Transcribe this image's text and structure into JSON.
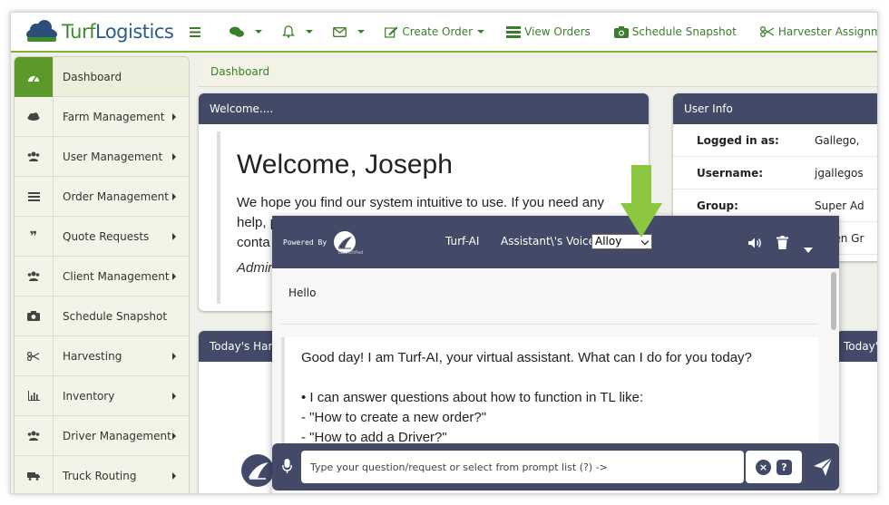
{
  "logo": {
    "part1": "Turf",
    "part2": "Logistics"
  },
  "nav": {
    "create_order": "Create Order",
    "view_orders": "View Orders",
    "schedule_snapshot": "Schedule Snapshot",
    "harvester_assignment": "Harvester Assignment"
  },
  "sidebar": {
    "items": [
      {
        "label": "Dashboard",
        "icon": "dashboard-icon"
      },
      {
        "label": "Farm Management",
        "icon": "cloud-icon"
      },
      {
        "label": "User Management",
        "icon": "users-icon"
      },
      {
        "label": "Order Management",
        "icon": "list-icon"
      },
      {
        "label": "Quote Requests",
        "icon": "quote-icon"
      },
      {
        "label": "Client Management",
        "icon": "users-icon"
      },
      {
        "label": "Schedule Snapshot",
        "icon": "camera-icon"
      },
      {
        "label": "Harvesting",
        "icon": "scissors-icon"
      },
      {
        "label": "Inventory",
        "icon": "bar-chart-icon"
      },
      {
        "label": "Driver Management",
        "icon": "users-icon"
      },
      {
        "label": "Truck Routing",
        "icon": "truck-icon"
      }
    ]
  },
  "breadcrumb": "Dashboard",
  "welcome": {
    "header": "Welcome....",
    "title": "Welcome, Joseph",
    "text_1": "We hope you find our system intuitive to use. If you need any",
    "text_2": "help, p",
    "text_3": "conta",
    "sign": "Admir"
  },
  "user_info": {
    "header": "User Info",
    "rows": [
      {
        "key": "Logged in as:",
        "value": "Gallego,"
      },
      {
        "key": "Username:",
        "value": "jgallegos"
      },
      {
        "key": "Group:",
        "value": "Super Ad"
      },
      {
        "key": "",
        "value": "Green Gr"
      }
    ]
  },
  "today_left": "Today's Harv",
  "today_right": "Today's",
  "chat": {
    "powered_by": "Powered By",
    "launchpad": "LaunchPad",
    "title": "Turf-AI",
    "voice_label": "Assistant\\'s Voice:",
    "voice_value": "Alloy",
    "user_message": "Hello",
    "bot_lines": [
      "Good day! I am Turf-AI, your virtual assistant. What can I do for you today?",
      "",
      "• I can answer questions about how to function in TL like:",
      "- \"How to create a new order?\"",
      "- \"How to add a Driver?\""
    ],
    "input_placeholder": "Type your question/request or select from prompt list (?) ->",
    "clear_label": "×",
    "help_label": "?"
  },
  "colors": {
    "accent_green": "#5b9a2a",
    "header_navy": "#434a68",
    "arrow_green": "#8dc63f"
  }
}
